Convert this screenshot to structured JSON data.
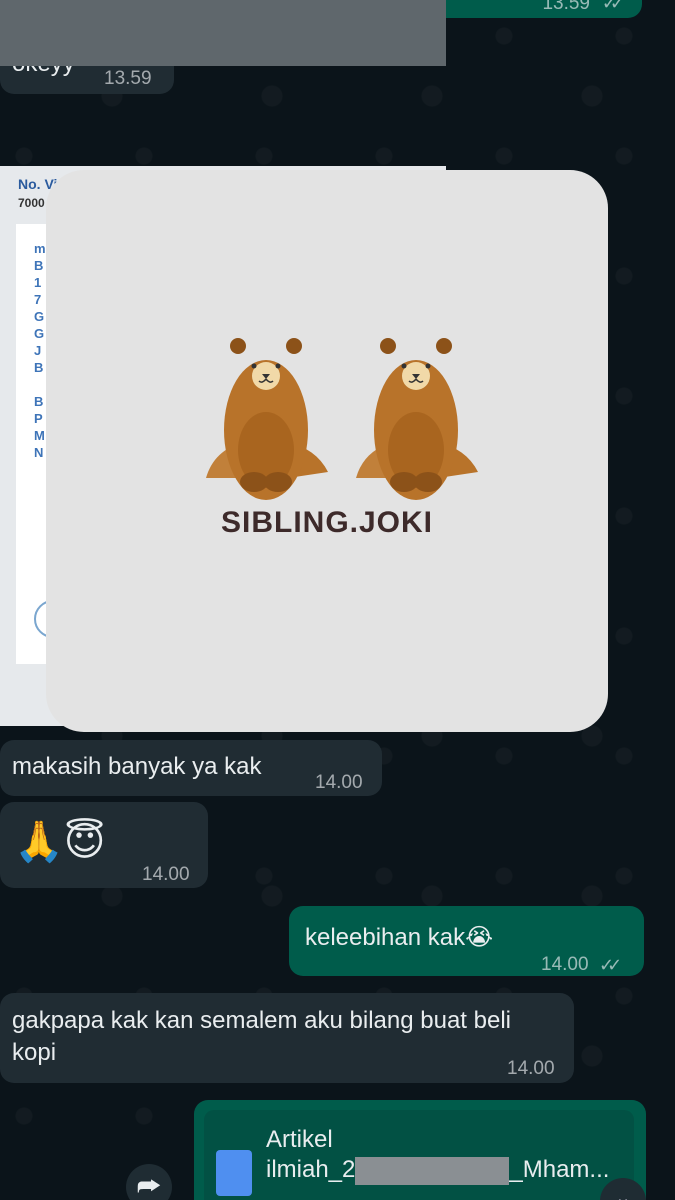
{
  "colors": {
    "background": "#0b141a",
    "incoming_bubble": "#202c33",
    "outgoing_bubble": "#005c4b",
    "logo_text": "#3d2a2a",
    "bear": "#b8732a"
  },
  "messages": [
    {
      "id": "top",
      "direction": "outgoing",
      "text": "",
      "time": "13.59",
      "status": "read"
    },
    {
      "id": "okey",
      "direction": "incoming",
      "text": "okeyy",
      "time": "13.59"
    },
    {
      "id": "image",
      "direction": "incoming",
      "type": "image",
      "doc_title": "No. Vi",
      "doc_number": "7000",
      "letters": [
        "m",
        "B",
        "1",
        "7",
        "G",
        "G",
        "J",
        "B",
        "",
        "B",
        "P",
        "M",
        "N"
      ]
    },
    {
      "id": "makasih",
      "direction": "incoming",
      "text": "makasih banyak ya kak",
      "time": "14.00"
    },
    {
      "id": "emoji",
      "direction": "incoming",
      "text": "🙏😇",
      "time": "14.00"
    },
    {
      "id": "kelee",
      "direction": "outgoing",
      "text": "keleebihan kak😭",
      "time": "14.00",
      "status": "read"
    },
    {
      "id": "gak",
      "direction": "incoming",
      "text": "gakpapa kak kan semalem aku bilang buat beli kopi",
      "time": "14.00"
    },
    {
      "id": "file",
      "direction": "outgoing",
      "type": "document",
      "name_line1": "Artikel",
      "name_line2_prefix": "ilmiah_2",
      "name_line2_suffix": "_Mham...",
      "icon": "document-icon"
    }
  ],
  "overlay": {
    "logo_text": "SIBLING.JOKI",
    "icon": "two-bears-logo"
  },
  "controls": {
    "forward_icon": "forward-icon",
    "scroll_down_icon": "chevron-down-icon"
  }
}
